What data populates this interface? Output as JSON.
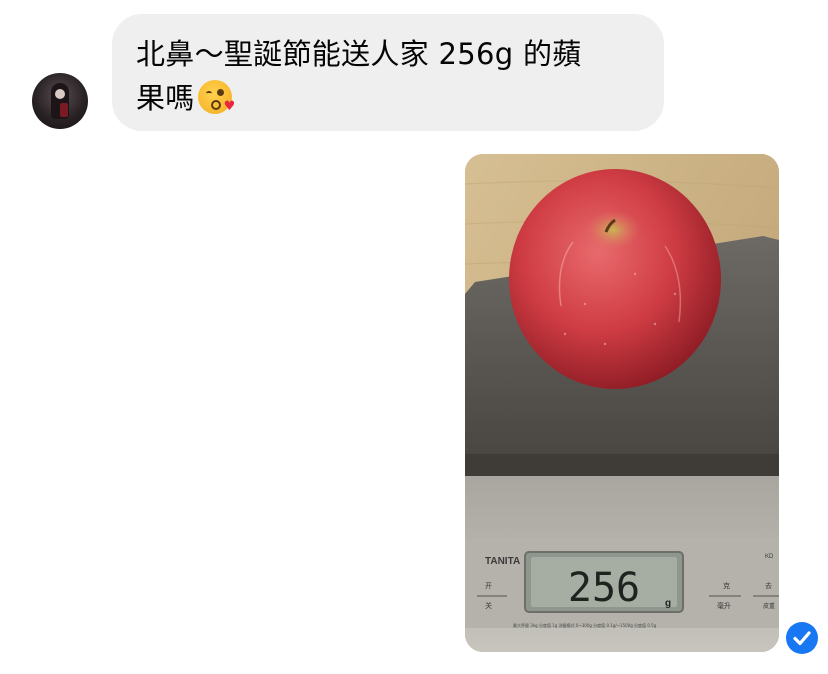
{
  "incoming": {
    "message_line1": "北鼻～聖誕節能送人家 256g 的蘋",
    "message_line2": "果嗎",
    "emoji": "face-blowing-a-kiss"
  },
  "outgoing": {
    "photo": {
      "subject": "apple-on-kitchen-scale",
      "scale_brand": "TANITA",
      "scale_reading": "256",
      "scale_unit": "g",
      "scale_label_left": "开",
      "scale_label_left2": "关",
      "scale_label_right": "克",
      "scale_label_right2": "毫升",
      "scale_label_far_right": "去",
      "scale_label_far_right2": "皮重",
      "scale_model": "KD",
      "scale_fineprint": "最大秤量 3kg 分度值 1g 测量模式 0~300g 分度值 0.1g/~1500g 分度值 0.5g"
    },
    "status": "seen"
  },
  "colors": {
    "bubble_bg": "#efefef",
    "seen_blue": "#1877f2"
  }
}
